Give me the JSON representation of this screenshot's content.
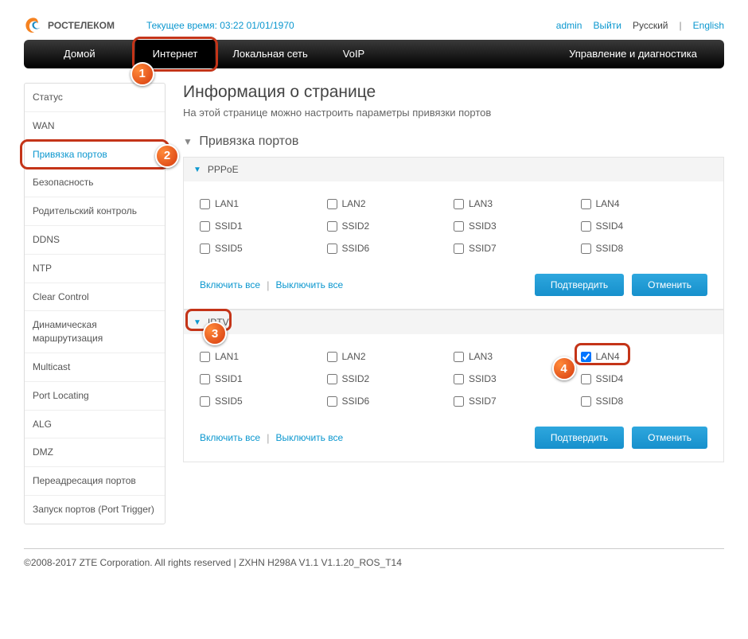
{
  "brand": "РОСТЕЛЕКОМ",
  "time": "Текущее время: 03:22 01/01/1970",
  "topRight": {
    "user": "admin",
    "logout": "Выйти",
    "lang_ru": "Русский",
    "lang_en": "English"
  },
  "nav": {
    "home": "Домой",
    "internet": "Интернет",
    "lan": "Локальная сеть",
    "voip": "VoIP",
    "diag": "Управление и диагностика"
  },
  "sidebar": [
    "Статус",
    "WAN",
    "Привязка портов",
    "Безопасность",
    "Родительский контроль",
    "DDNS",
    "NTP",
    "Clear Control",
    "Динамическая маршрутизация",
    "Multicast",
    "Port Locating",
    "ALG",
    "DMZ",
    "Переадресация портов",
    "Запуск портов (Port Trigger)"
  ],
  "page": {
    "title": "Информация о странице",
    "desc": "На этой странице можно настроить параметры привязки портов",
    "section": "Привязка портов"
  },
  "ports": {
    "lan1": "LAN1",
    "lan2": "LAN2",
    "lan3": "LAN3",
    "lan4": "LAN4",
    "ssid1": "SSID1",
    "ssid2": "SSID2",
    "ssid3": "SSID3",
    "ssid4": "SSID4",
    "ssid5": "SSID5",
    "ssid6": "SSID6",
    "ssid7": "SSID7",
    "ssid8": "SSID8"
  },
  "group1": {
    "name": "PPPoE"
  },
  "group2": {
    "name": "IPTV"
  },
  "actions": {
    "enableAll": "Включить все",
    "disableAll": "Выключить все",
    "confirm": "Подтвердить",
    "cancel": "Отменить"
  },
  "footer": "©2008-2017 ZTE Corporation. All rights reserved   |   ZXHN H298A V1.1 V1.1.20_ROS_T14",
  "markers": {
    "m1": "1",
    "m2": "2",
    "m3": "3",
    "m4": "4"
  }
}
